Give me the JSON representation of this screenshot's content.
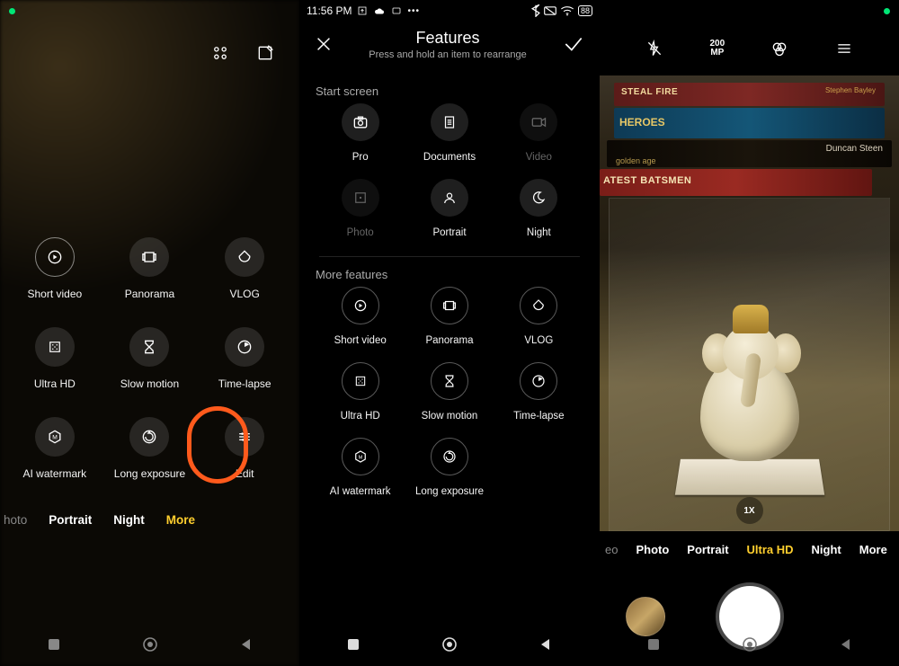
{
  "status": {
    "time": "11:56 PM",
    "battery_pct": "88"
  },
  "left": {
    "modes": {
      "photo": "hoto",
      "portrait": "Portrait",
      "night": "Night",
      "more": "More"
    },
    "features": {
      "short_video": "Short video",
      "panorama": "Panorama",
      "vlog": "VLOG",
      "ultra_hd": "Ultra HD",
      "slow_motion": "Slow motion",
      "time_lapse": "Time-lapse",
      "ai_watermark": "AI watermark",
      "long_exposure": "Long exposure",
      "edit": "Edit"
    }
  },
  "mid": {
    "title": "Features",
    "subtitle": "Press and hold an item to rearrange",
    "section_start": "Start screen",
    "section_more": "More features",
    "start_items": {
      "pro": "Pro",
      "documents": "Documents",
      "video": "Video",
      "photo": "Photo",
      "portrait": "Portrait",
      "night": "Night"
    },
    "more_items": {
      "short_video": "Short video",
      "panorama": "Panorama",
      "vlog": "VLOG",
      "ultra_hd": "Ultra HD",
      "slow_motion": "Slow motion",
      "time_lapse": "Time-lapse",
      "ai_watermark": "AI watermark",
      "long_exposure": "Long exposure"
    }
  },
  "right": {
    "resolution_top": "200",
    "resolution_bottom": "MP",
    "zoom": "1X",
    "modes": {
      "eo": "eo",
      "photo": "Photo",
      "portrait": "Portrait",
      "ultra_hd": "Ultra HD",
      "night": "Night",
      "more": "More"
    },
    "books": {
      "b1": "STEAL FIRE",
      "b1a": "Stephen Bayley",
      "b2": "HEROES",
      "b3": "Duncan Steen",
      "b3a": "golden age",
      "b4": "ATEST BATSMEN"
    }
  }
}
